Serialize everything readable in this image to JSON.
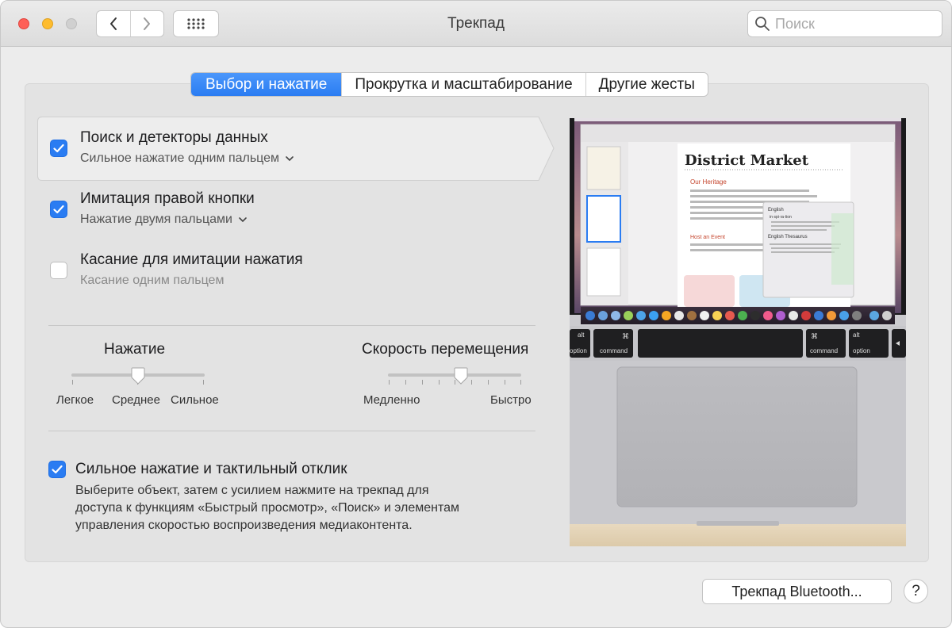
{
  "window": {
    "title": "Трекпад"
  },
  "search": {
    "placeholder": "Поиск"
  },
  "tabs": [
    {
      "label": "Выбор и нажатие",
      "active": true
    },
    {
      "label": "Прокрутка и масштабирование",
      "active": false
    },
    {
      "label": "Другие жесты",
      "active": false
    }
  ],
  "options": [
    {
      "title": "Поиск и детекторы данных",
      "subtitle": "Сильное нажатие одним пальцем",
      "checked": true,
      "has_dropdown": true,
      "selected": true
    },
    {
      "title": "Имитация правой кнопки",
      "subtitle": "Нажатие двумя пальцами",
      "checked": true,
      "has_dropdown": true
    },
    {
      "title": "Касание для имитации нажатия",
      "subtitle": "Касание одним пальцем",
      "checked": false,
      "has_dropdown": false
    }
  ],
  "sliders": {
    "click": {
      "title": "Нажатие",
      "labels": [
        "Легкое",
        "Среднее",
        "Сильное"
      ],
      "value_index": 1,
      "value_fraction": 0.5
    },
    "tracking": {
      "title": "Скорость перемещения",
      "min_label": "Медленно",
      "max_label": "Быстро",
      "value_fraction": 0.55
    }
  },
  "force_click": {
    "title": "Сильное нажатие и тактильный отклик",
    "checked": true,
    "description_lines": [
      "Выберите объект, затем с усилием нажмите на трекпад для",
      "доступа к функциям «Быстрый просмотр», «Поиск» и элементам",
      "управления скоростью воспроизведения медиаконтента."
    ]
  },
  "preview": {
    "doc_title": "District Market",
    "heading1": "Our Heritage",
    "heading2": "Host an Event",
    "popup_lang": "English",
    "popup_thesaurus": "English Thesaurus",
    "popup_word": "in·spi·ra·tion",
    "key_labels": {
      "alt": "alt",
      "option": "option",
      "cmd_symbol": "⌘",
      "command": "command"
    }
  },
  "footer": {
    "bluetooth_button": "Трекпад Bluetooth...",
    "help_label": "?"
  },
  "colors": {
    "accent": "#2a7cf2",
    "window_bg": "#ececec",
    "panel_bg": "#e3e3e3"
  }
}
